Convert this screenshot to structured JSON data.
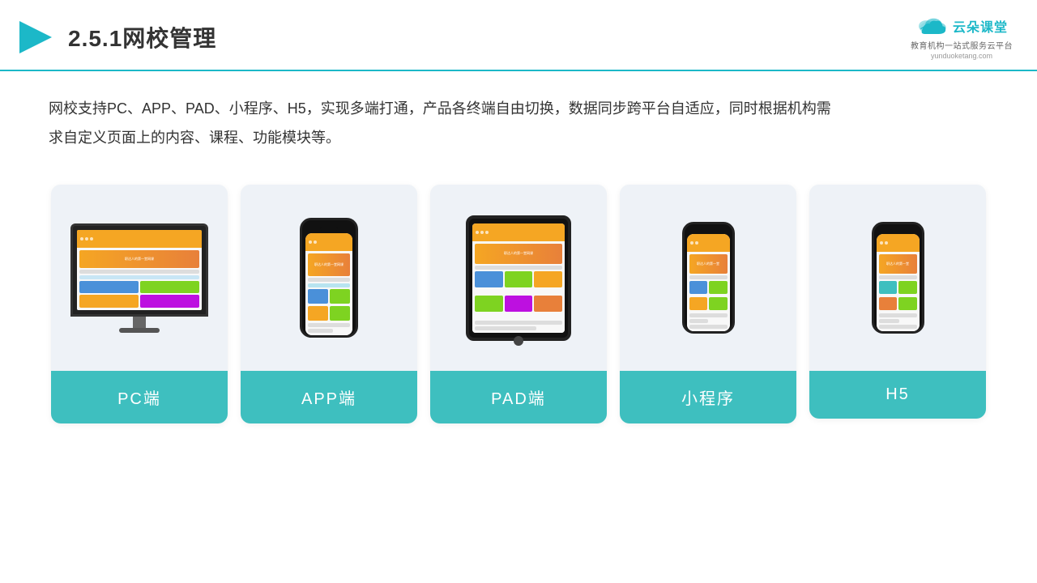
{
  "header": {
    "title": "2.5.1网校管理",
    "logo_text": "云朵课堂",
    "logo_sub": "教育机构一站式服务云平台",
    "logo_domain": "yunduoketang.com"
  },
  "description": {
    "text": "网校支持PC、APP、PAD、小程序、H5，实现多端打通，产品各终端自由切换，数据同步跨平台自适应，同时根据机构需求自定义页面上的内容、课程、功能模块等。"
  },
  "cards": [
    {
      "label": "PC端",
      "type": "pc"
    },
    {
      "label": "APP端",
      "type": "phone"
    },
    {
      "label": "PAD端",
      "type": "tablet"
    },
    {
      "label": "小程序",
      "type": "phone_small"
    },
    {
      "label": "H5",
      "type": "phone_small2"
    }
  ]
}
